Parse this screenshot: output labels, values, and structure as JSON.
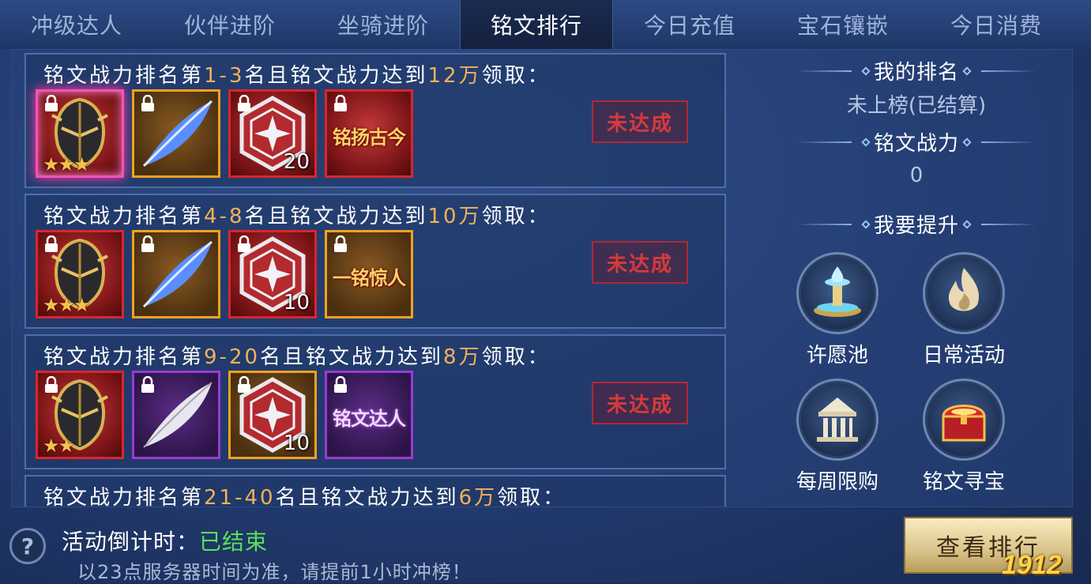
{
  "tabs": [
    {
      "label": "冲级达人",
      "active": false
    },
    {
      "label": "伙伴进阶",
      "active": false
    },
    {
      "label": "坐骑进阶",
      "active": false
    },
    {
      "label": "铭文排行",
      "active": true
    },
    {
      "label": "今日充值",
      "active": false
    },
    {
      "label": "宝石镶嵌",
      "active": false
    },
    {
      "label": "今日消费",
      "active": false
    }
  ],
  "rewards": [
    {
      "title_prefix": "铭文战力排名第",
      "rank": "1-3",
      "title_mid": "名且铭文战力达到",
      "power": "12万",
      "title_suffix": "领取：",
      "status": "未达成",
      "items": [
        {
          "icon": "helmet-icon",
          "frame": "pink",
          "stars": "★★★",
          "count": ""
        },
        {
          "icon": "feather-icon",
          "frame": "orange",
          "stars": "",
          "count": ""
        },
        {
          "icon": "rune-icon",
          "frame": "red",
          "stars": "",
          "count": "20"
        },
        {
          "icon": "title-badge-icon",
          "frame": "red",
          "stars": "",
          "count": "",
          "text": "铭扬古今"
        }
      ]
    },
    {
      "title_prefix": "铭文战力排名第",
      "rank": "4-8",
      "title_mid": "名且铭文战力达到",
      "power": "10万",
      "title_suffix": "领取：",
      "status": "未达成",
      "items": [
        {
          "icon": "helmet-icon",
          "frame": "red",
          "stars": "★★★",
          "count": ""
        },
        {
          "icon": "feather-icon",
          "frame": "orange",
          "stars": "",
          "count": ""
        },
        {
          "icon": "rune-icon",
          "frame": "red",
          "stars": "",
          "count": "10"
        },
        {
          "icon": "title-badge-icon",
          "frame": "orange",
          "stars": "",
          "count": "",
          "text": "一铭惊人"
        }
      ]
    },
    {
      "title_prefix": "铭文战力排名第",
      "rank": "9-20",
      "title_mid": "名且铭文战力达到",
      "power": "8万",
      "title_suffix": "领取：",
      "status": "未达成",
      "items": [
        {
          "icon": "helmet-icon",
          "frame": "red",
          "stars": "★★",
          "count": ""
        },
        {
          "icon": "feather-icon",
          "frame": "purple",
          "stars": "",
          "count": ""
        },
        {
          "icon": "rune-icon",
          "frame": "orange",
          "stars": "",
          "count": "10"
        },
        {
          "icon": "title-badge-icon",
          "frame": "purple",
          "stars": "",
          "count": "",
          "text": "铭文达人"
        }
      ]
    },
    {
      "title_prefix": "铭文战力排名第",
      "rank": "21-40",
      "title_mid": "名且铭文战力达到",
      "power": "6万",
      "title_suffix": "领取：",
      "status": "",
      "items": []
    }
  ],
  "side": {
    "my_rank_label": "我的排名",
    "my_rank_value": "未上榜(已结算)",
    "power_label": "铭文战力",
    "power_value": "0",
    "improve_label": "我要提升",
    "shortcuts": [
      {
        "label": "许愿池",
        "icon": "fountain-icon"
      },
      {
        "label": "日常活动",
        "icon": "flame-icon"
      },
      {
        "label": "每周限购",
        "icon": "temple-icon"
      },
      {
        "label": "铭文寻宝",
        "icon": "treasure-chest-icon"
      }
    ]
  },
  "footer": {
    "countdown_label": "活动倒计时：",
    "countdown_value": "已结束",
    "notice": "以23点服务器时间为准，请提前1小时冲榜！",
    "rank_button": "查看排行",
    "help_icon": "?"
  },
  "watermark": "1912"
}
